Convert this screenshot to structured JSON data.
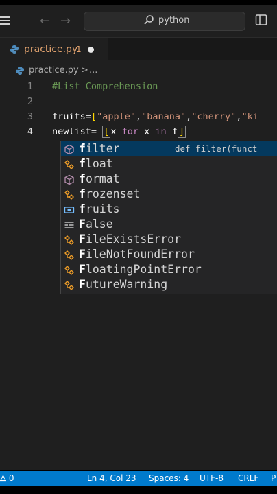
{
  "titlebar": {
    "search_text": "python",
    "icons": [
      "menu-icon",
      "back-arrow-icon",
      "forward-arrow-icon",
      "search-icon",
      "layout-icon"
    ]
  },
  "tab": {
    "label": "practice.py",
    "problems": "1",
    "file_icon": "python-file-icon"
  },
  "breadcrumb": {
    "file": "practice.py",
    "separator": ">",
    "more": "..."
  },
  "code": {
    "lines": [
      {
        "number": "1",
        "text": "#List Comprehension"
      },
      {
        "number": "2",
        "text": ""
      },
      {
        "number": "3",
        "text": "fruits=[\"apple\",\"banana\",\"cherry\",\"ki"
      },
      {
        "number": "4",
        "text": "newlist= [x for x in f]"
      }
    ],
    "line3": {
      "var": "fruits",
      "eq": "=",
      "open": "[",
      "s1": "\"apple\"",
      "s2": "\"banana\"",
      "s3": "\"cherry\"",
      "s4": "\"ki",
      "comma": ","
    },
    "line4": {
      "var": "newlist",
      "eq": "=",
      "sp": " ",
      "open": "[",
      "x1": "x",
      "for": "for",
      "x2": "x",
      "in": "in",
      "f": "f",
      "close": "]"
    }
  },
  "suggestions": [
    {
      "match": "f",
      "rest": "ilter",
      "icon": "cube-icon",
      "detail": "def filter(funct",
      "selected": true
    },
    {
      "match": "f",
      "rest": "loat",
      "icon": "class-icon"
    },
    {
      "match": "f",
      "rest": "ormat",
      "icon": "cube-icon"
    },
    {
      "match": "f",
      "rest": "rozenset",
      "icon": "class-icon"
    },
    {
      "match": "f",
      "rest": "ruits",
      "icon": "variable-icon"
    },
    {
      "match": "F",
      "rest": "alse",
      "icon": "keyword-icon"
    },
    {
      "match": "F",
      "rest": "ileExistsError",
      "icon": "class-icon"
    },
    {
      "match": "F",
      "rest": "ileNotFoundError",
      "icon": "class-icon"
    },
    {
      "match": "F",
      "rest": "loatingPointError",
      "icon": "class-icon"
    },
    {
      "match": "F",
      "rest": "utureWarning",
      "icon": "class-icon"
    }
  ],
  "statusbar": {
    "problems": "0",
    "position": "Ln 4, Col 23",
    "spaces": "Spaces: 4",
    "encoding": "UTF-8",
    "eol": "CRLF",
    "lang": "P"
  },
  "colors": {
    "accent": "#007acc",
    "comment": "#6a9955",
    "string": "#ce9178",
    "keyword": "#c586c0",
    "bracket": "#ffd700",
    "modified_tab": "#e2a36f"
  }
}
